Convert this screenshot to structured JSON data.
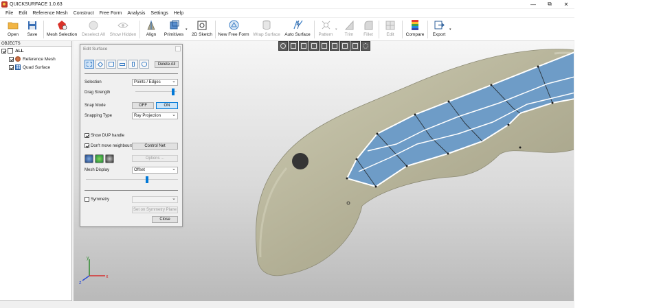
{
  "window": {
    "title": "QUICKSURFACE 1.0.63",
    "minimize": "—",
    "maximize": "⧉",
    "close": "✕"
  },
  "menu": [
    "File",
    "Edit",
    "Reference Mesh",
    "Construct",
    "Free Form",
    "Analysis",
    "Settings",
    "Help"
  ],
  "toolbar": {
    "open": "Open",
    "save": "Save",
    "mesh_selection": "Mesh Selection",
    "deselect_all": "Deselect All",
    "show_hidden": "Show Hidden",
    "align": "Align",
    "primitives": "Primitives",
    "sketch_2d": "2D Sketch",
    "new_free_form": "New Free Form",
    "wrap_surface": "Wrap Surface",
    "auto_surface": "Auto Surface",
    "pattern": "Pattern",
    "trim": "Trim",
    "fillet": "Fillet",
    "edit": "Edit",
    "compare": "Compare",
    "export": "Export"
  },
  "objects": {
    "header": "OBJECTS",
    "items": [
      "ALL",
      "Reference Mesh",
      "Quad Surface"
    ]
  },
  "dialog": {
    "title": "Edit Surface",
    "delete_all": "Delete All",
    "selection_label": "Selection",
    "selection_value": "Points / Edges",
    "drag_strength_label": "Drag Strength",
    "drag_strength_level": 0.95,
    "snap_mode_label": "Snap Mode",
    "snap_off": "OFF",
    "snap_on": "ON",
    "snapping_type_label": "Snapping Type",
    "snapping_type_value": "Ray Projection",
    "show_dup_handle": "Show DUP handle",
    "dont_move_neighbours": "Don't move neighbours",
    "control_net": "Control Net",
    "options": "Options ...",
    "mesh_display_label": "Mesh Display",
    "mesh_display_value": "Offset",
    "mesh_slider_level": 0.67,
    "symmetry": "Symmetry",
    "set_on_symmetry_plane": "Set on Symmetry Plane",
    "close": "Close"
  },
  "axis": {
    "x": "x",
    "y": "y",
    "z": "z"
  },
  "colors": {
    "surface": "#6e9cc7",
    "mesh": "#b9b79b",
    "accent": "#0078d7"
  }
}
